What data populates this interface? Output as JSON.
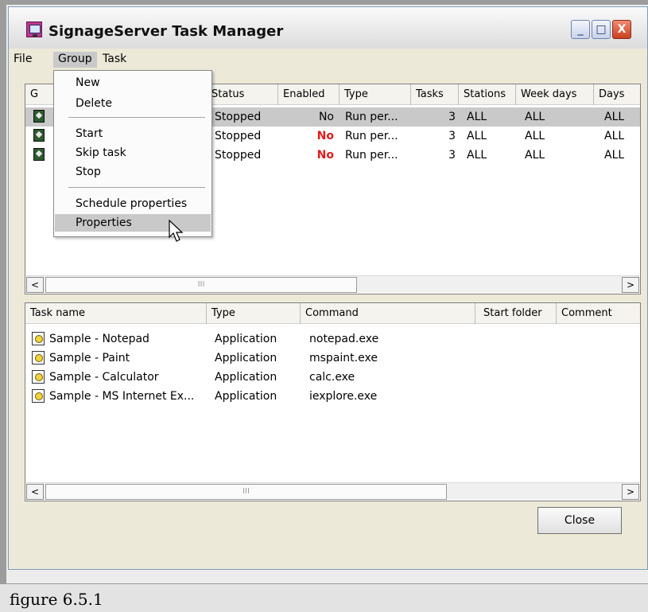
{
  "window": {
    "title": "SignageServer Task Manager",
    "controls": {
      "minimize": "_",
      "maximize": "□",
      "close": "X"
    }
  },
  "menubar": {
    "items": [
      "File",
      "Group",
      "Task"
    ]
  },
  "group_menu": {
    "items": [
      "New",
      "Delete",
      "Start",
      "Skip task",
      "Stop",
      "Schedule properties",
      "Properties"
    ],
    "highlighted": "Properties"
  },
  "groups_table": {
    "columns": [
      "G",
      "Status",
      "Enabled",
      "Type",
      "Tasks",
      "Stations",
      "Week days",
      "Days"
    ],
    "rows": [
      {
        "status": "Stopped",
        "enabled": "No",
        "type": "Run per...",
        "tasks": "3",
        "stations": "ALL",
        "week_days": "ALL",
        "days": "ALL",
        "selected": true
      },
      {
        "status": "Stopped",
        "enabled": "No",
        "type": "Run per...",
        "tasks": "3",
        "stations": "ALL",
        "week_days": "ALL",
        "days": "ALL",
        "selected": false
      },
      {
        "status": "Stopped",
        "enabled": "No",
        "type": "Run per...",
        "tasks": "3",
        "stations": "ALL",
        "week_days": "ALL",
        "days": "ALL",
        "selected": false
      }
    ]
  },
  "tasks_table": {
    "columns": [
      "Task name",
      "Type",
      "Command",
      "Start folder",
      "Comment"
    ],
    "rows": [
      {
        "name": "Sample - Notepad",
        "type": "Application",
        "command": "notepad.exe"
      },
      {
        "name": "Sample - Paint",
        "type": "Application",
        "command": "mspaint.exe"
      },
      {
        "name": "Sample - Calculator",
        "type": "Application",
        "command": "calc.exe"
      },
      {
        "name": "Sample - MS Internet Ex...",
        "type": "Application",
        "command": "iexplore.exe"
      }
    ]
  },
  "buttons": {
    "close": "Close"
  },
  "scroll": {
    "left": "<",
    "right": ">",
    "grip": "III"
  },
  "caption": "figure 6.5.1",
  "colors": {
    "disabled_red": "#e11b1b",
    "selection_gray": "#c9c9c9"
  }
}
